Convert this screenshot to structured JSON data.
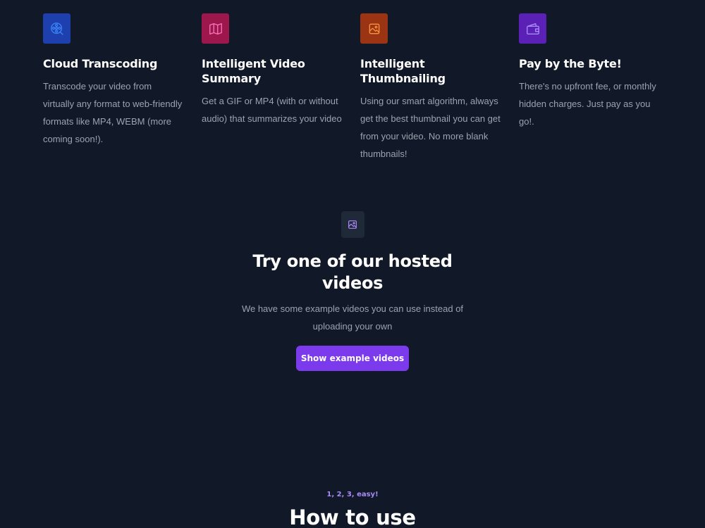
{
  "colors": {
    "background": "#111827",
    "accent": "#7c3aed",
    "icon_bg_blue": "#1e40af",
    "icon_bg_pink": "#9d174d",
    "icon_bg_orange": "#9a3412",
    "icon_bg_purple": "#5b21b6"
  },
  "features": [
    {
      "icon": "film-reel-icon",
      "title": "Cloud Transcoding",
      "description": "Transcode your video from virtually any format to web-friendly formats like MP4, WEBM (more coming soon!)."
    },
    {
      "icon": "map-icon",
      "title": "Intelligent Video Summary",
      "description": "Get a GIF or MP4 (with or without audio) that summarizes your video"
    },
    {
      "icon": "image-icon",
      "title": "Intelligent Thumbnailing",
      "description": "Using our smart algorithm, always get the best thumbnail you can get from your video. No more blank thumbnails!"
    },
    {
      "icon": "wallet-icon",
      "title": "Pay by the Byte!",
      "description": "There's no upfront fee, or monthly hidden charges. Just pay as you go!."
    }
  ],
  "hosted": {
    "icon": "image-icon",
    "title": "Try one of our hosted videos",
    "description": "We have some example videos you can use instead of uploading your own",
    "button_label": "Show example videos"
  },
  "howto": {
    "eyebrow": "1, 2, 3, easy!",
    "title": "How to use"
  }
}
